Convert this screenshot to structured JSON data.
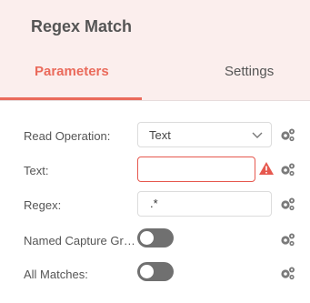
{
  "title": "Regex Match",
  "tabs": [
    {
      "label": "Parameters",
      "active": true
    },
    {
      "label": "Settings",
      "active": false
    }
  ],
  "fields": {
    "read_operation": {
      "label": "Read Operation:",
      "value": "Text"
    },
    "text": {
      "label": "Text:",
      "value": "",
      "error": true
    },
    "regex": {
      "label": "Regex:",
      "value": ".*"
    },
    "named_capture": {
      "label": "Named Capture Groups:",
      "on": false
    },
    "all_matches": {
      "label": "All Matches:",
      "on": false
    }
  },
  "colors": {
    "accent": "#ea6a5b",
    "header_bg": "#fbeeed",
    "toggle_off": "#707070",
    "error_border": "#e6584e"
  },
  "icons": {
    "options": "gears-icon",
    "dropdown": "chevron-down-icon",
    "warning": "warning-icon"
  }
}
